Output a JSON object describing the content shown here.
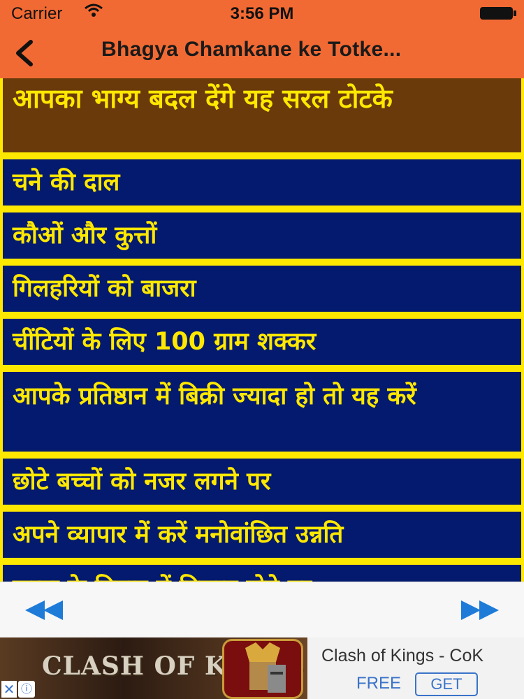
{
  "status_bar": {
    "carrier": "Carrier",
    "time": "3:56 PM"
  },
  "nav": {
    "title": "Bhagya Chamkane ke Totke..."
  },
  "list": {
    "items": [
      {
        "label": "आपका भाग्य बदल देंगे यह सरल टोटके"
      },
      {
        "label": "चने की दाल"
      },
      {
        "label": "कौओं और कुत्तों"
      },
      {
        "label": "गिलहरियों को बाजरा"
      },
      {
        "label": "चींटियों के लिए 100 ग्राम शक्कर"
      },
      {
        "label": "आपके प्रतिष्ठान में बिक्री ज्यादा हो तो यह करें"
      },
      {
        "label": "छोटे बच्चों को नजर लगने पर"
      },
      {
        "label": "अपने व्यापार में करें मनोवांछित उन्नति"
      },
      {
        "label": "कन्या के विवाह में विलम्ब होने पर"
      }
    ]
  },
  "ad": {
    "banner_text": "CLASH OF KINGS",
    "app_name": "Clash of Kings - CoK",
    "price": "FREE",
    "get_label": "GET"
  },
  "colors": {
    "header_bar": "#f26a33",
    "list_background": "#ffe800",
    "row_background": "#041a6e",
    "first_row_background": "#6a3a0a",
    "row_text": "#ffe800",
    "arrow": "#1e7bd8"
  }
}
